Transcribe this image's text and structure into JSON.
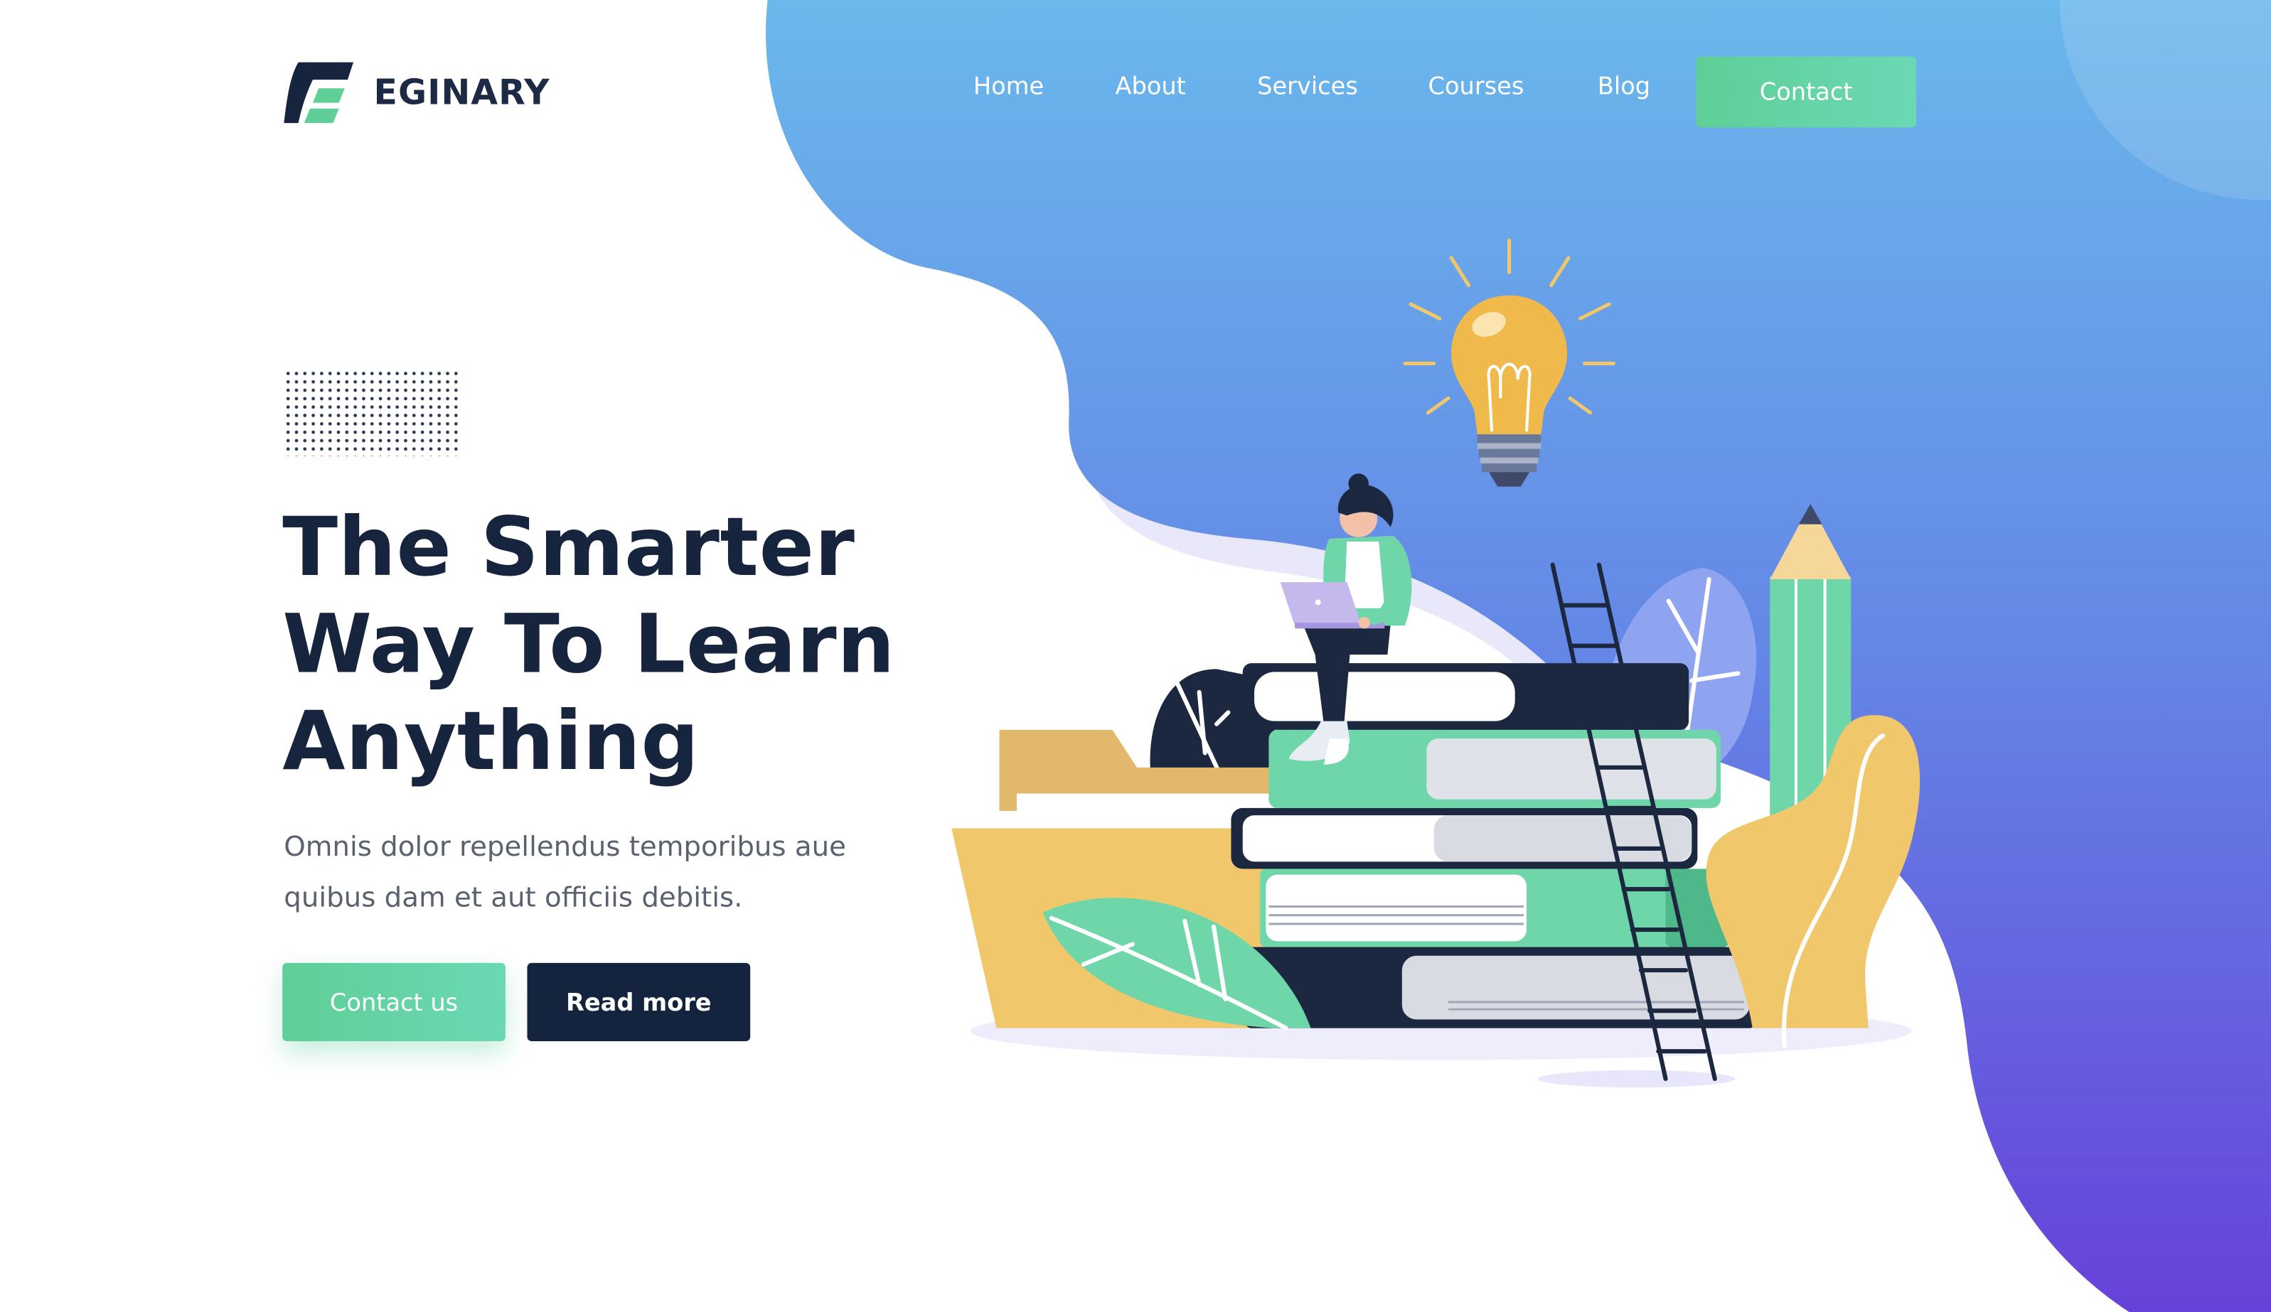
{
  "brand": {
    "name": "EGINARY",
    "logo_icon": "stylized-e-icon",
    "colors": {
      "navy": "#17243e",
      "green": "#5fcf97",
      "blue_top": "#6ab8ec",
      "purple_bottom": "#6a3fdc",
      "yellow": "#f0c76b"
    }
  },
  "nav": {
    "items": [
      {
        "label": "Home"
      },
      {
        "label": "About"
      },
      {
        "label": "Services"
      },
      {
        "label": "Courses"
      },
      {
        "label": "Blog"
      }
    ],
    "contact_label": "Contact"
  },
  "hero": {
    "title_lines": [
      "The Smarter",
      "Way To Learn",
      "Anything"
    ],
    "description_lines": [
      "Omnis dolor repellendus temporibus aue",
      "quibus dam et aut officiis debitis."
    ],
    "primary_button": "Contact us",
    "secondary_button": "Read more"
  },
  "illustration": {
    "subject": "woman-with-laptop-on-book-stack-icon",
    "elements": [
      "lightbulb-icon",
      "ladder-icon",
      "pencil-icon",
      "folder-icon",
      "leaf-icon",
      "book-stack-icon"
    ]
  }
}
